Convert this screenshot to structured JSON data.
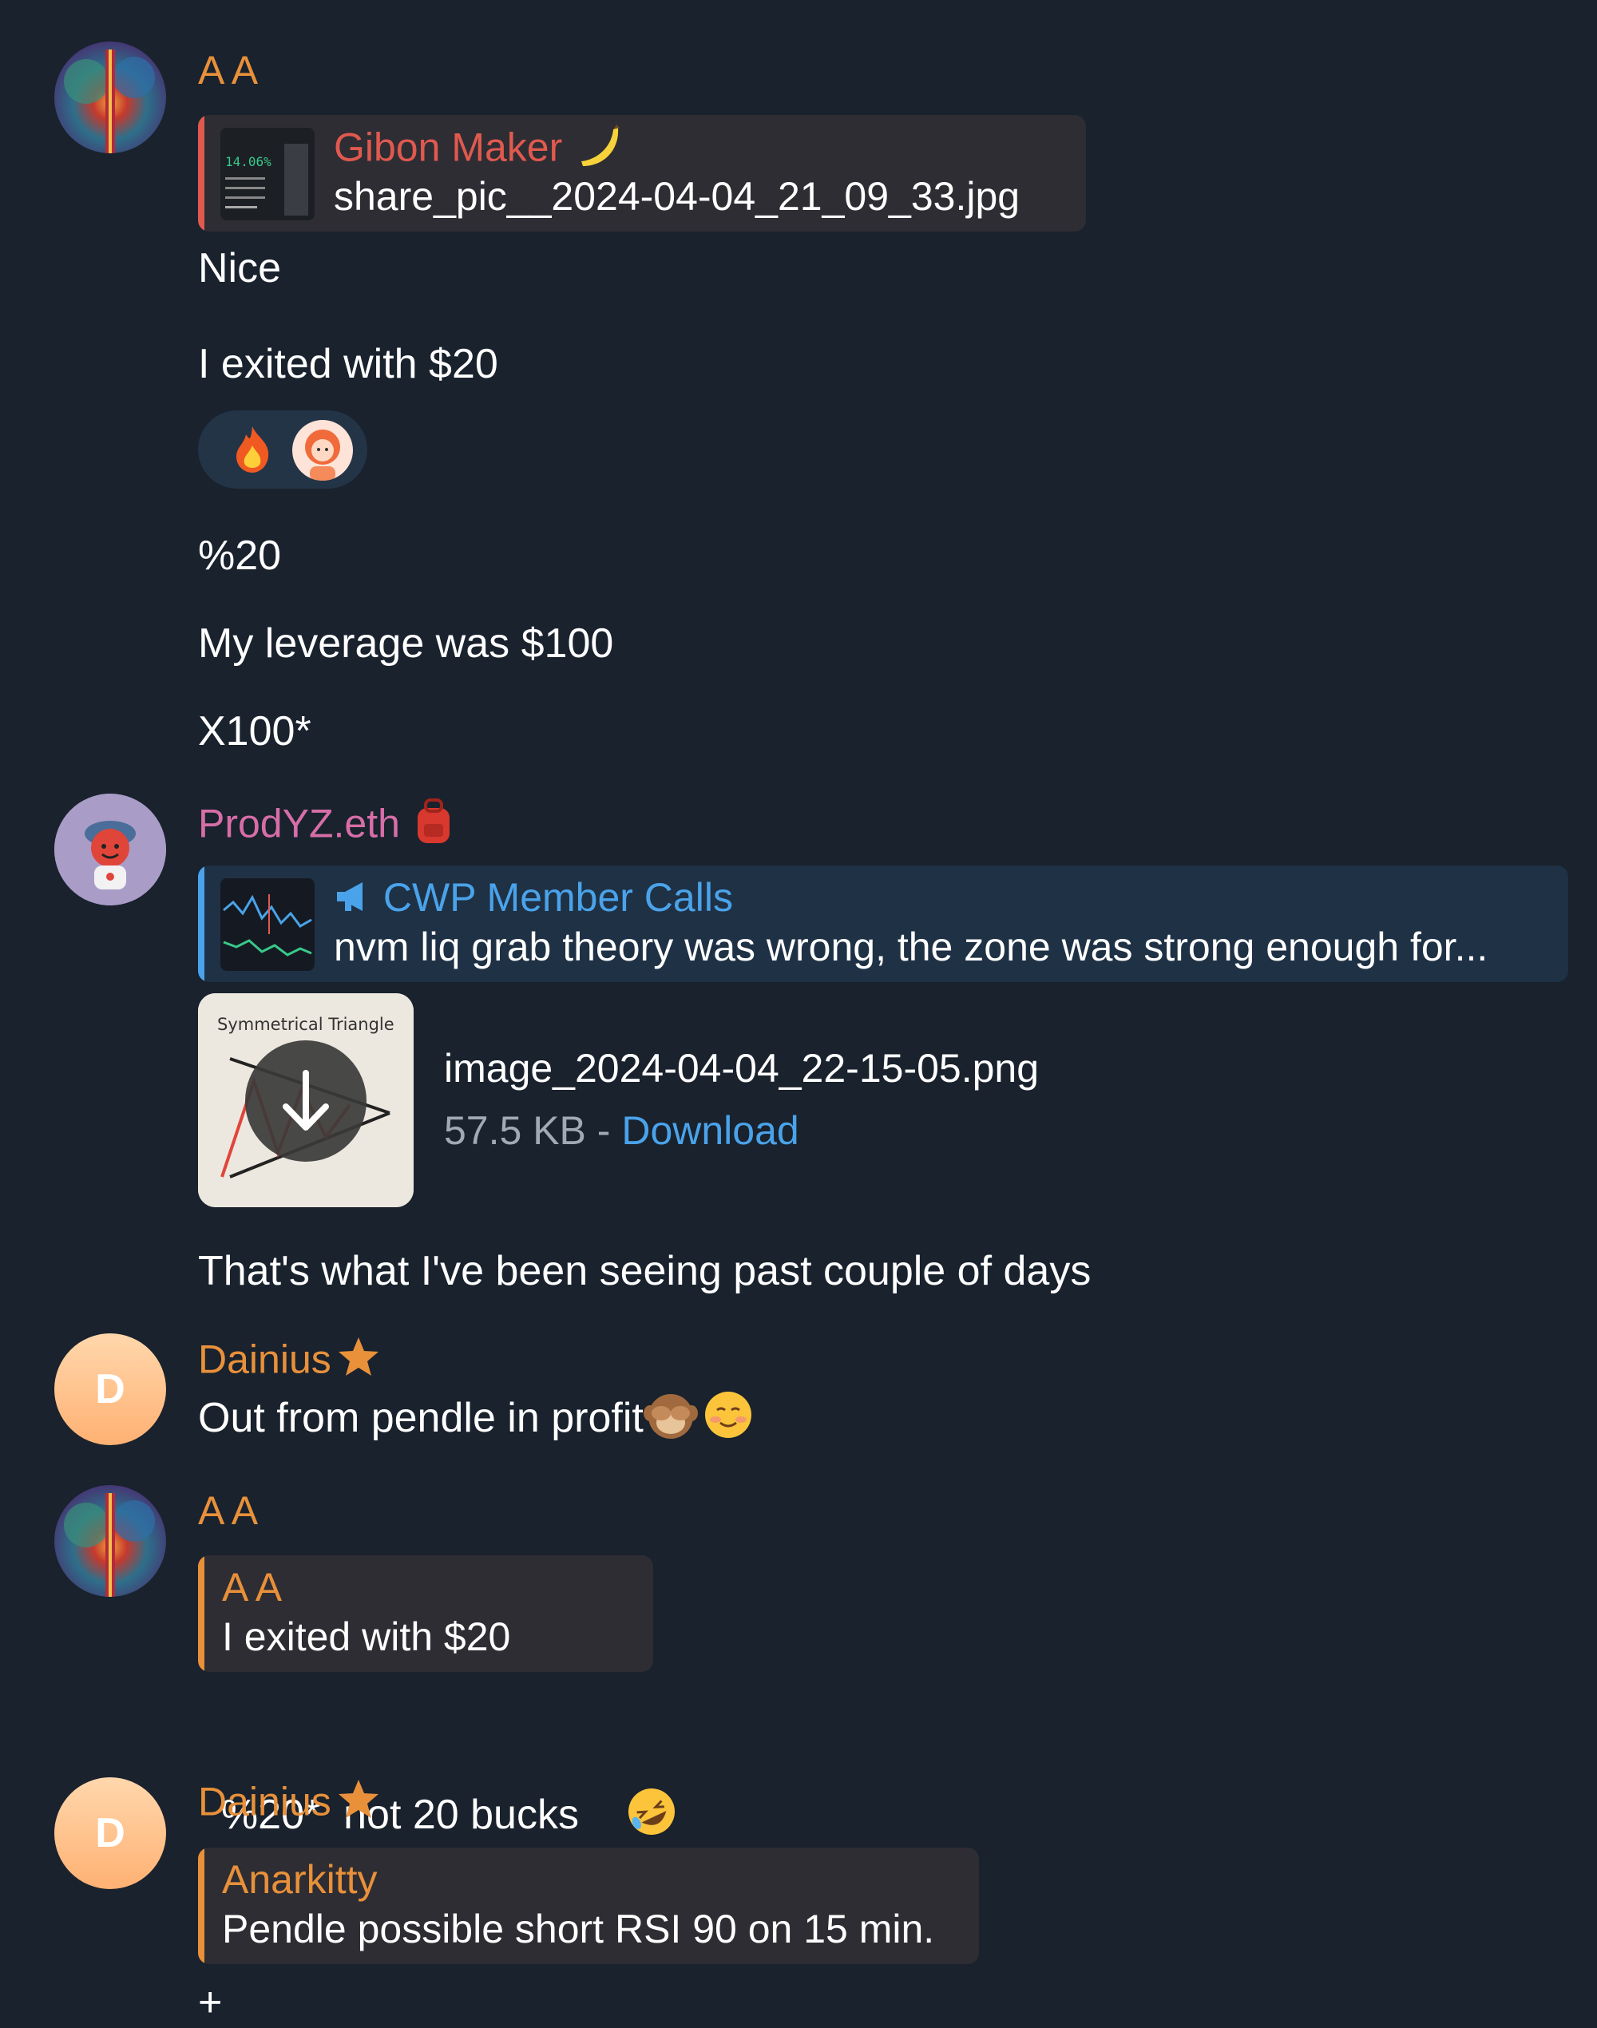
{
  "colors": {
    "background": "#19222d",
    "orange_name": "#e8903a",
    "red_name": "#e0594f",
    "pink_name": "#d76ea8",
    "link_blue": "#4aa3ea",
    "reply_bg": "#2e2d33",
    "forward_bg": "#1f3145"
  },
  "messages": [
    {
      "sender": "A A",
      "reply": {
        "name": "Gibon Maker",
        "name_icon": "banana-icon",
        "text": "share_pic__2024-04-04_21_09_33.jpg"
      },
      "lines": [
        "Nice",
        "I exited with $20"
      ],
      "reactions": [
        "fire-icon",
        "reactor-avatar"
      ],
      "followups": [
        "%20",
        "My leverage was $100",
        "X100*"
      ]
    },
    {
      "sender": "ProdYZ.eth",
      "sender_icon": "backpack-icon",
      "forward": {
        "channel_icon": "megaphone-icon",
        "name": "CWP Member Calls",
        "text": "nvm liq grab theory was wrong, the zone was strong enough for..."
      },
      "file": {
        "thumb_label": "Symmetrical Triangle",
        "name": "image_2024-04-04_22-15-05.png",
        "size": "57.5 KB",
        "separator": " - ",
        "action": "Download"
      },
      "lines": [
        "That's what I've been seeing past couple of days"
      ]
    },
    {
      "sender": "Dainius",
      "avatar_letter": "D",
      "text": "Out from pendle in profit"
    },
    {
      "sender": "A A",
      "reply": {
        "name": "A A",
        "text": "I exited with $20"
      },
      "text": "%20*  not 20 bucks"
    },
    {
      "sender": "Dainius",
      "avatar_letter": "D",
      "reply": {
        "name": "Anarkitty",
        "text": "Pendle possible short RSI 90 on 15 min."
      },
      "trailing": "+"
    }
  ]
}
